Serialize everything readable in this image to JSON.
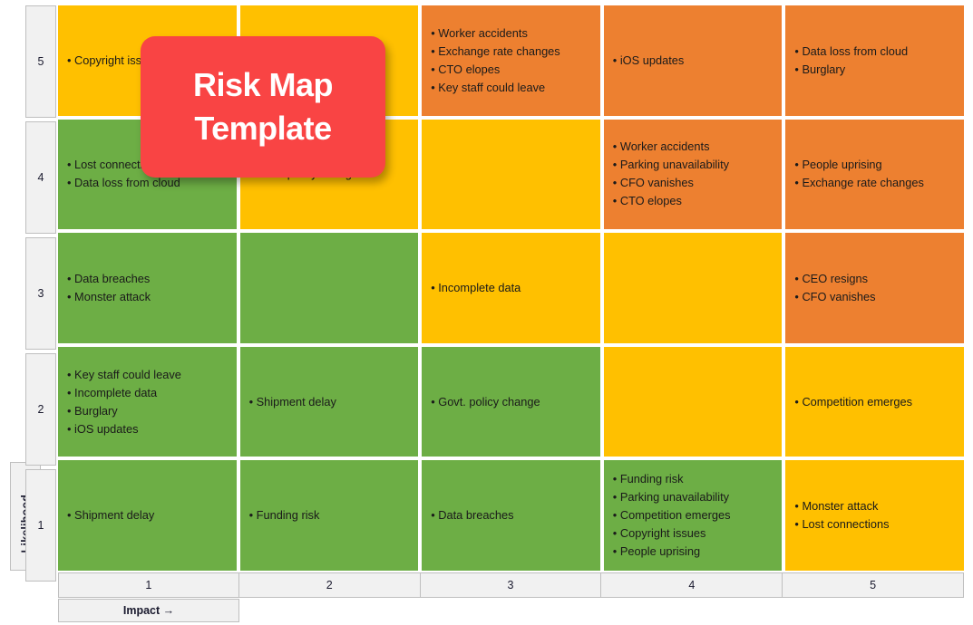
{
  "banner": {
    "line1": "Risk Map",
    "line2": "Template",
    "color": "#F94444"
  },
  "axes": {
    "y_title": "Likelihood →",
    "x_title": "Impact →",
    "y_ticks": [
      "5",
      "4",
      "3",
      "2",
      "1"
    ],
    "x_ticks": [
      "1",
      "2",
      "3",
      "4",
      "5"
    ]
  },
  "legend_colors": {
    "low": "#6DAE45",
    "medium": "#FFC000",
    "high": "#ED8030"
  },
  "chart_data": {
    "type": "heatmap",
    "title": "Risk Map Template",
    "xlabel": "Impact →",
    "ylabel": "Likelihood →",
    "x": [
      "1",
      "2",
      "3",
      "4",
      "5"
    ],
    "y": [
      "5",
      "4",
      "3",
      "2",
      "1"
    ],
    "grid": false,
    "legend_position": "none",
    "color_scale": {
      "green": "#6DAE45",
      "yellow": "#FFC000",
      "orange": "#ED8030"
    },
    "cells": [
      {
        "likelihood": 5,
        "impact": 1,
        "level": "yellow",
        "items": [
          "Copyright issues"
        ]
      },
      {
        "likelihood": 5,
        "impact": 2,
        "level": "yellow",
        "items": []
      },
      {
        "likelihood": 5,
        "impact": 3,
        "level": "orange",
        "items": [
          "Worker accidents",
          "Exchange rate changes",
          "CTO elopes",
          "Key staff could leave"
        ]
      },
      {
        "likelihood": 5,
        "impact": 4,
        "level": "orange",
        "items": [
          "iOS updates"
        ]
      },
      {
        "likelihood": 5,
        "impact": 5,
        "level": "orange",
        "items": [
          "Data loss from cloud",
          "Burglary"
        ]
      },
      {
        "likelihood": 4,
        "impact": 1,
        "level": "green",
        "items": [
          "Lost connections",
          "Data loss from cloud"
        ]
      },
      {
        "likelihood": 4,
        "impact": 2,
        "level": "yellow",
        "items": [
          "Govt. policy change"
        ]
      },
      {
        "likelihood": 4,
        "impact": 3,
        "level": "yellow",
        "items": []
      },
      {
        "likelihood": 4,
        "impact": 4,
        "level": "orange",
        "items": [
          "Worker accidents",
          "Parking unavailability",
          "CFO vanishes",
          "CTO elopes"
        ]
      },
      {
        "likelihood": 4,
        "impact": 5,
        "level": "orange",
        "items": [
          "People uprising",
          "Exchange rate changes"
        ]
      },
      {
        "likelihood": 3,
        "impact": 1,
        "level": "green",
        "items": [
          "Data breaches",
          "Monster attack"
        ]
      },
      {
        "likelihood": 3,
        "impact": 2,
        "level": "green",
        "items": []
      },
      {
        "likelihood": 3,
        "impact": 3,
        "level": "yellow",
        "items": [
          "Incomplete data"
        ]
      },
      {
        "likelihood": 3,
        "impact": 4,
        "level": "yellow",
        "items": []
      },
      {
        "likelihood": 3,
        "impact": 5,
        "level": "orange",
        "items": [
          "CEO resigns",
          "CFO vanishes"
        ]
      },
      {
        "likelihood": 2,
        "impact": 1,
        "level": "green",
        "items": [
          "Key staff could leave",
          "Incomplete data",
          "Burglary",
          "iOS updates"
        ]
      },
      {
        "likelihood": 2,
        "impact": 2,
        "level": "green",
        "items": [
          "Shipment delay"
        ]
      },
      {
        "likelihood": 2,
        "impact": 3,
        "level": "green",
        "items": [
          "Govt. policy change"
        ]
      },
      {
        "likelihood": 2,
        "impact": 4,
        "level": "yellow",
        "items": []
      },
      {
        "likelihood": 2,
        "impact": 5,
        "level": "yellow",
        "items": [
          "Competition emerges"
        ]
      },
      {
        "likelihood": 1,
        "impact": 1,
        "level": "green",
        "items": [
          "Shipment delay"
        ]
      },
      {
        "likelihood": 1,
        "impact": 2,
        "level": "green",
        "items": [
          "Funding risk"
        ]
      },
      {
        "likelihood": 1,
        "impact": 3,
        "level": "green",
        "items": [
          "Data breaches"
        ]
      },
      {
        "likelihood": 1,
        "impact": 4,
        "level": "green",
        "items": [
          "Funding risk",
          "Parking unavailability",
          "Competition emerges",
          "Copyright issues",
          "People uprising"
        ]
      },
      {
        "likelihood": 1,
        "impact": 5,
        "level": "yellow",
        "items": [
          "Monster attack",
          "Lost connections"
        ]
      }
    ]
  }
}
